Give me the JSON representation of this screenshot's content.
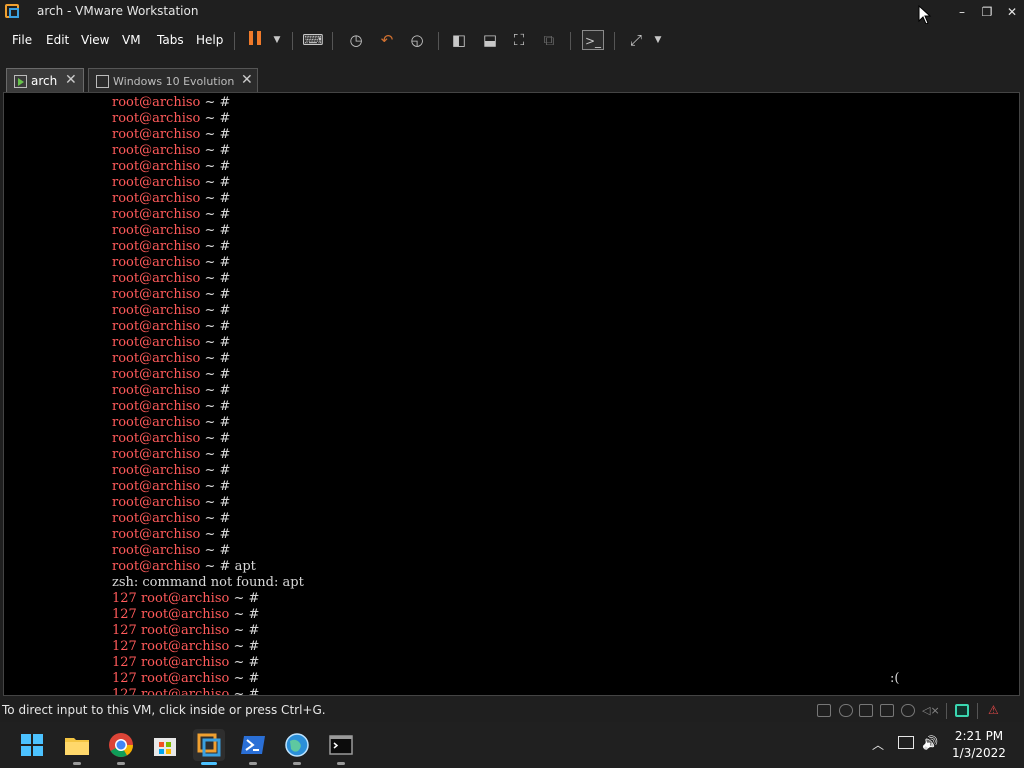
{
  "window": {
    "title": "arch - VMware Workstation",
    "min_glyph": "–",
    "max_glyph": "❐",
    "close_glyph": "✕"
  },
  "menu": [
    "File",
    "Edit",
    "View",
    "VM",
    "Tabs",
    "Help"
  ],
  "tabs": [
    {
      "label": "arch",
      "active": true,
      "close": "✕"
    },
    {
      "label": "Windows 10 Evolution",
      "active": false,
      "close": "✕"
    }
  ],
  "terminal": {
    "prompt_user": "root@archiso",
    "prompt_rest": " ~ #",
    "command": " apt",
    "error": "zsh: command not found: apt",
    "exit_code": "127 ",
    "cursor": " _",
    "plain_prompt_count": 29,
    "error_prompt_count": 7,
    "sad_face": ":(",
    "prompt_color": "#ff5a5a"
  },
  "status": {
    "text": "To direct input to this VM, click inside or press Ctrl+G."
  },
  "taskbar": {
    "apps": [
      "start-icon",
      "file-explorer-icon",
      "chrome-icon",
      "microsoft-store-icon",
      "vmware-icon",
      "powershell-icon",
      "network-globe-icon",
      "terminal-icon"
    ],
    "time": "2:21 PM",
    "date": "1/3/2022",
    "chevron_glyph": "︿",
    "volume_glyph": "🔊"
  }
}
